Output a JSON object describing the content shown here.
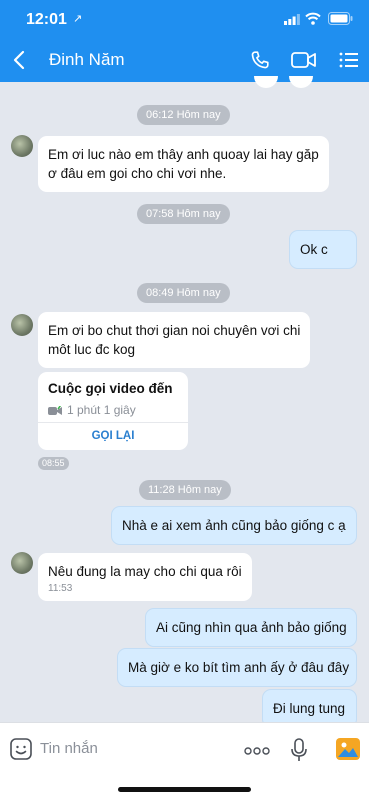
{
  "status": {
    "time": "12:01",
    "location_glyph": "↗"
  },
  "header": {
    "contact_name": "Đinh Năm"
  },
  "icons": {
    "back": "chevron-left-icon",
    "call": "phone-icon",
    "video": "video-camera-icon",
    "menu": "list-menu-icon",
    "emoji": "emoji-icon",
    "more": "more-dots-icon",
    "mic": "microphone-icon",
    "photo": "image-icon"
  },
  "colors": {
    "header_bg": "#1f8ff0",
    "incoming_bg": "#ffffff",
    "outgoing_bg": "#d6ecff",
    "chat_bg": "#e3e7ee",
    "link": "#2a7fcf"
  },
  "messages": {
    "stamp1": "06:12 Hôm nay",
    "m1_l1": "Em ơi luc nào em thây anh quoay lai  hay găp",
    "m1_l2": "ơ đâu em goi cho chi   vơi nhe.",
    "stamp2": "07:58 Hôm nay",
    "m2": "Ok c",
    "stamp3": "08:49 Hôm nay",
    "m3_l1": "Em ơi bo chut thơi gian noi chuyên vơi chi",
    "m3_l2": "môt luc đc kog",
    "call_title": "Cuộc gọi video đến",
    "call_duration": "1 phút 1 giây",
    "call_action": "GỌI LẠI",
    "call_time": "08:55",
    "stamp4": "11:28 Hôm nay",
    "m4": "Nhà e ai xem ảnh cũng bảo giống c ạ",
    "m5": "Nêu đung  la may cho chi qua rôi",
    "m5_time": "11:53",
    "m6": "Ai cũng nhìn qua ảnh bảo giống",
    "m7": "Mà giờ e ko bít tìm anh ấy ở đâu đây",
    "m8": "Đi lung tung"
  },
  "composer": {
    "placeholder": "Tin nhắn"
  }
}
